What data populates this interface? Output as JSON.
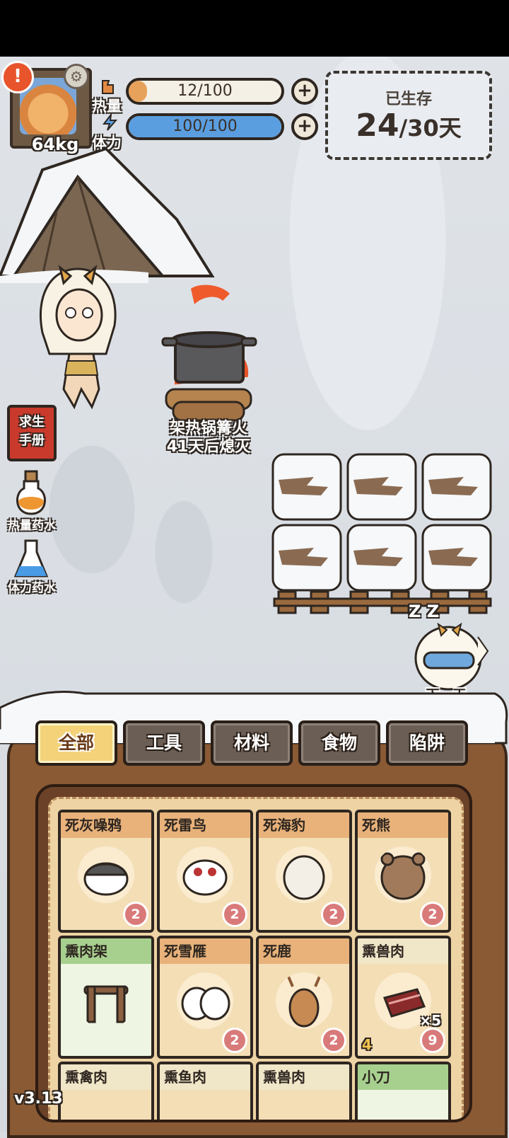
{
  "player": {
    "weight": "64kg"
  },
  "stats": {
    "heat": {
      "label": "热量",
      "value": "12/100",
      "fill_fraction": 0.12,
      "color": "#e6a25b"
    },
    "stamina": {
      "label": "体力",
      "value": "100/100",
      "fill_fraction": 1.0,
      "color": "#5a9ee0"
    }
  },
  "survival": {
    "label": "已生存",
    "days": "24",
    "separator": "/",
    "total": "30天"
  },
  "campfire": {
    "name": "架热锅篝火",
    "status": "41天后熄灭"
  },
  "sidebar": {
    "book_line1": "求生",
    "book_line2": "手册",
    "heat_potion": "热量药水",
    "stamina_potion": "体力药水"
  },
  "next_day": {
    "sleep": "Z Z",
    "label": "下一天"
  },
  "tabs": [
    {
      "label": "全部",
      "active": true
    },
    {
      "label": "工具",
      "active": false
    },
    {
      "label": "材料",
      "active": false
    },
    {
      "label": "食物",
      "active": false
    },
    {
      "label": "陷阱",
      "active": false
    }
  ],
  "inventory": [
    {
      "name": "死灰噪鸦",
      "badge": "2",
      "icon": "crow-icon"
    },
    {
      "name": "死雷鸟",
      "badge": "2",
      "icon": "ptarmigan-icon"
    },
    {
      "name": "死海豹",
      "badge": "2",
      "icon": "seal-icon"
    },
    {
      "name": "死熊",
      "badge": "2",
      "icon": "bear-icon"
    },
    {
      "name": "熏肉架",
      "icon": "rack-icon"
    },
    {
      "name": "死雪雁",
      "badge": "2",
      "icon": "goose-icon"
    },
    {
      "name": "死鹿",
      "badge": "2",
      "icon": "deer-icon"
    },
    {
      "name": "熏兽肉",
      "badge": "9",
      "quantity": "×5",
      "level": "4",
      "icon": "meat-icon"
    },
    {
      "name": "熏禽肉"
    },
    {
      "name": "熏鱼肉"
    },
    {
      "name": "熏兽肉"
    },
    {
      "name": "小刀"
    }
  ],
  "version": "v3.13"
}
